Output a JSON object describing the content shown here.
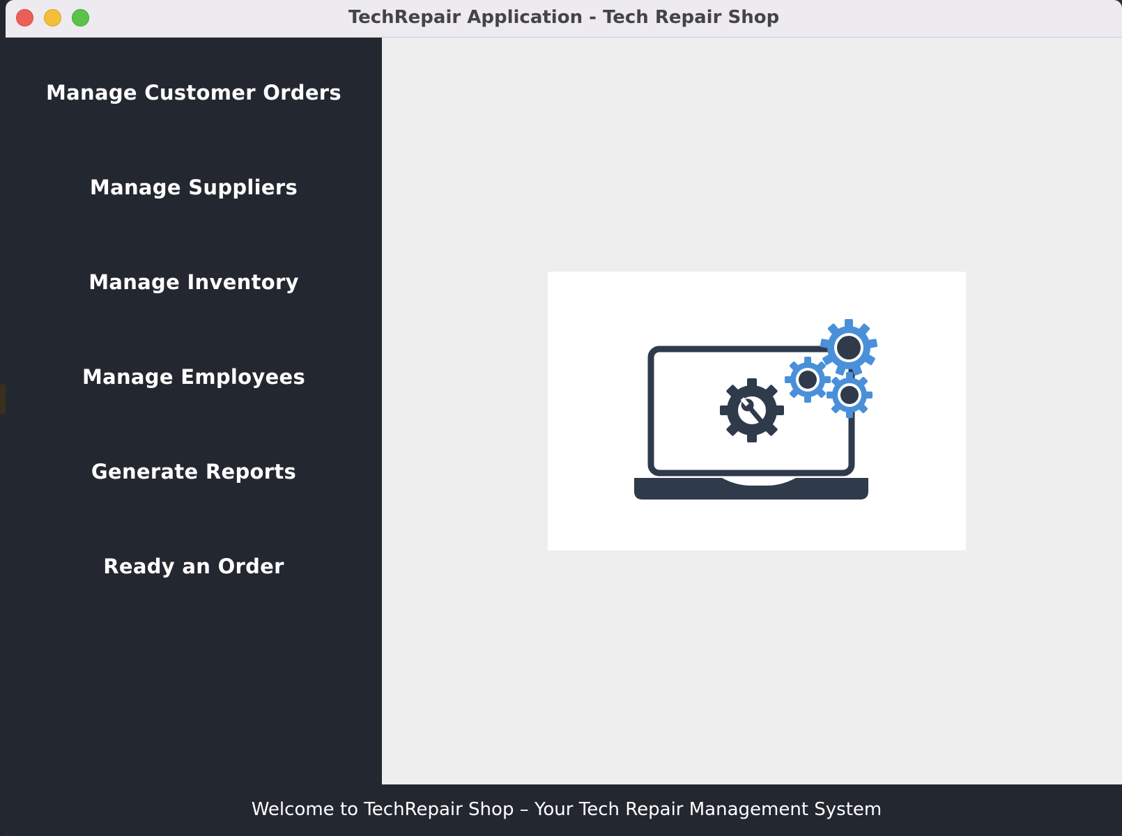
{
  "window": {
    "title": "TechRepair Application - Tech Repair Shop"
  },
  "sidebar": {
    "items": [
      {
        "label": "Manage Customer Orders"
      },
      {
        "label": "Manage Suppliers"
      },
      {
        "label": "Manage Inventory"
      },
      {
        "label": "Manage Employees"
      },
      {
        "label": "Generate Reports"
      },
      {
        "label": "Ready an Order"
      }
    ]
  },
  "main": {
    "image_icon": "laptop-gears-icon"
  },
  "statusbar": {
    "text": "Welcome to TechRepair Shop – Your Tech Repair Management System"
  },
  "colors": {
    "sidebar_bg": "#232730",
    "content_bg": "#eeeeef",
    "icon_dark": "#2f3a4b",
    "icon_blue": "#4a90d9"
  }
}
